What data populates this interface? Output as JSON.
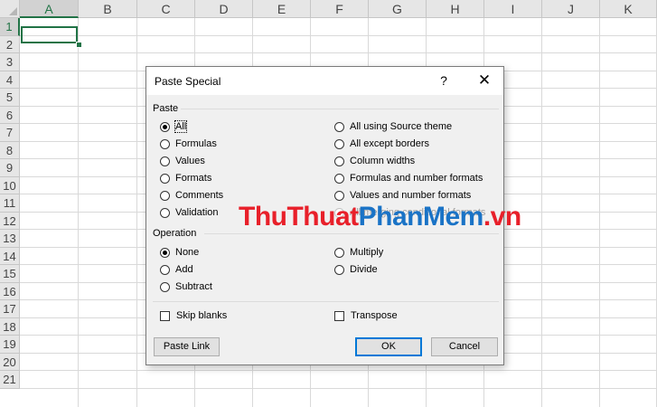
{
  "sheet": {
    "columns": [
      "A",
      "B",
      "C",
      "D",
      "E",
      "F",
      "G",
      "H",
      "I",
      "J",
      "K"
    ],
    "rows": [
      "1",
      "2",
      "3",
      "4",
      "5",
      "6",
      "7",
      "8",
      "9",
      "10",
      "11",
      "12",
      "13",
      "14",
      "15",
      "16",
      "17",
      "18",
      "19",
      "20",
      "21"
    ],
    "selected_column": "A",
    "selected_row": "1",
    "accent_color": "#217346"
  },
  "dialog": {
    "title": "Paste Special",
    "help": "?",
    "close": "✕",
    "paste_group": {
      "label": "Paste",
      "options_left": [
        "All",
        "Formulas",
        "Values",
        "Formats",
        "Comments",
        "Validation"
      ],
      "options_right": [
        "All using Source theme",
        "All except borders",
        "Column widths",
        "Formulas and number formats",
        "Values and number formats",
        "All merging conditional formats"
      ],
      "selected": "All",
      "disabled": [
        "All merging conditional formats"
      ]
    },
    "operation_group": {
      "label": "Operation",
      "options_left": [
        "None",
        "Add",
        "Subtract"
      ],
      "options_right": [
        "Multiply",
        "Divide"
      ],
      "selected": "None"
    },
    "skip_blanks": "Skip blanks",
    "transpose": "Transpose",
    "paste_link_button": "Paste Link",
    "ok_button": "OK",
    "cancel_button": "Cancel",
    "default_button_color": "#0078d7"
  },
  "watermark": {
    "part1": "ThuThuat",
    "part2": "PhanMem",
    "part3": ".vn"
  }
}
